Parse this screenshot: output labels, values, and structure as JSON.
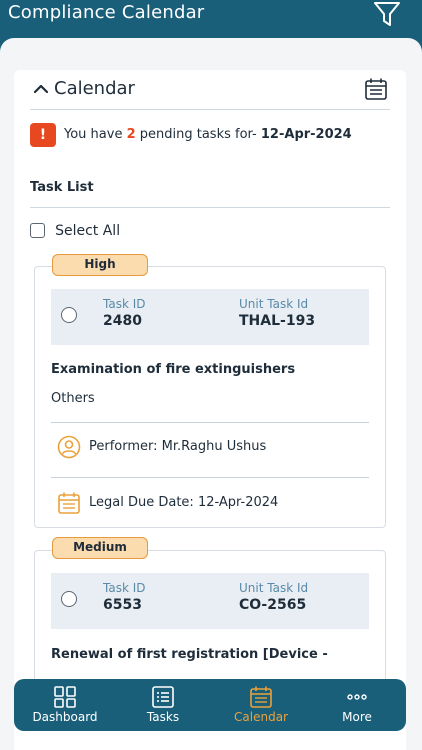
{
  "header": {
    "title": "Compliance Calendar"
  },
  "calendar": {
    "title": "Calendar",
    "pending_prefix": "You have",
    "pending_count": "2",
    "pending_middle": "pending tasks for-",
    "pending_date": "12-Apr-2024"
  },
  "task_list": {
    "title": "Task List",
    "select_all": "Select All",
    "tasks": [
      {
        "priority": "High",
        "task_id_label": "Task ID",
        "task_id": "2480",
        "unit_task_label": "Unit Task Id",
        "unit_task_id": "THAL-193",
        "title": "Examination of fire extinguishers",
        "category": "Others",
        "performer": "Performer: Mr.Raghu Ushus",
        "due_date": "Legal Due Date: 12-Apr-2024"
      },
      {
        "priority": "Medium",
        "task_id_label": "Task ID",
        "task_id": "6553",
        "unit_task_label": "Unit Task Id",
        "unit_task_id": "CO-2565",
        "title": "Renewal of first registration [Device -"
      }
    ]
  },
  "nav": {
    "active": "Calendar",
    "items": [
      {
        "label": "Dashboard",
        "icon": "dashboard-icon"
      },
      {
        "label": "Tasks",
        "icon": "tasks-icon"
      },
      {
        "label": "Calendar",
        "icon": "calendar-icon"
      },
      {
        "label": "More",
        "icon": "more-icon"
      }
    ]
  },
  "colors": {
    "primary": "#1a5f7a",
    "accent": "#e9a23b",
    "alert": "#e8481f",
    "badge_bg": "#fbdcae"
  }
}
